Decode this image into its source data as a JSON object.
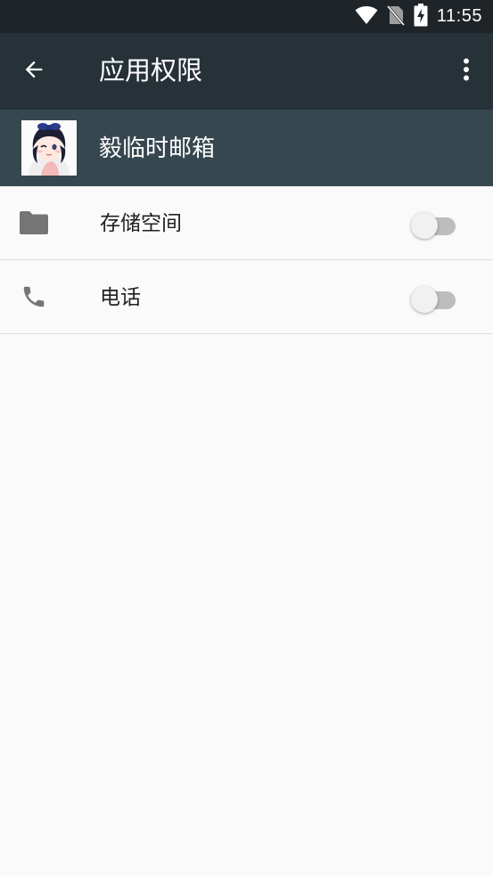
{
  "status_bar": {
    "time": "11:55",
    "icons": [
      "wifi-icon",
      "no-sim-icon",
      "battery-charging-icon"
    ]
  },
  "app_bar": {
    "title": "应用权限",
    "back_icon": "arrow-back-icon",
    "menu_icon": "more-vert-icon"
  },
  "app_header": {
    "name": "毅临时邮箱",
    "icon": "app-avatar-image"
  },
  "permissions": [
    {
      "label": "存储空间",
      "icon": "folder-icon",
      "enabled": false
    },
    {
      "label": "电话",
      "icon": "phone-icon",
      "enabled": false
    }
  ],
  "colors": {
    "status_bar": "#1f2429",
    "app_bar": "#263238",
    "app_header": "#37474f",
    "background": "#fafafa",
    "icon_gray": "#757575"
  }
}
